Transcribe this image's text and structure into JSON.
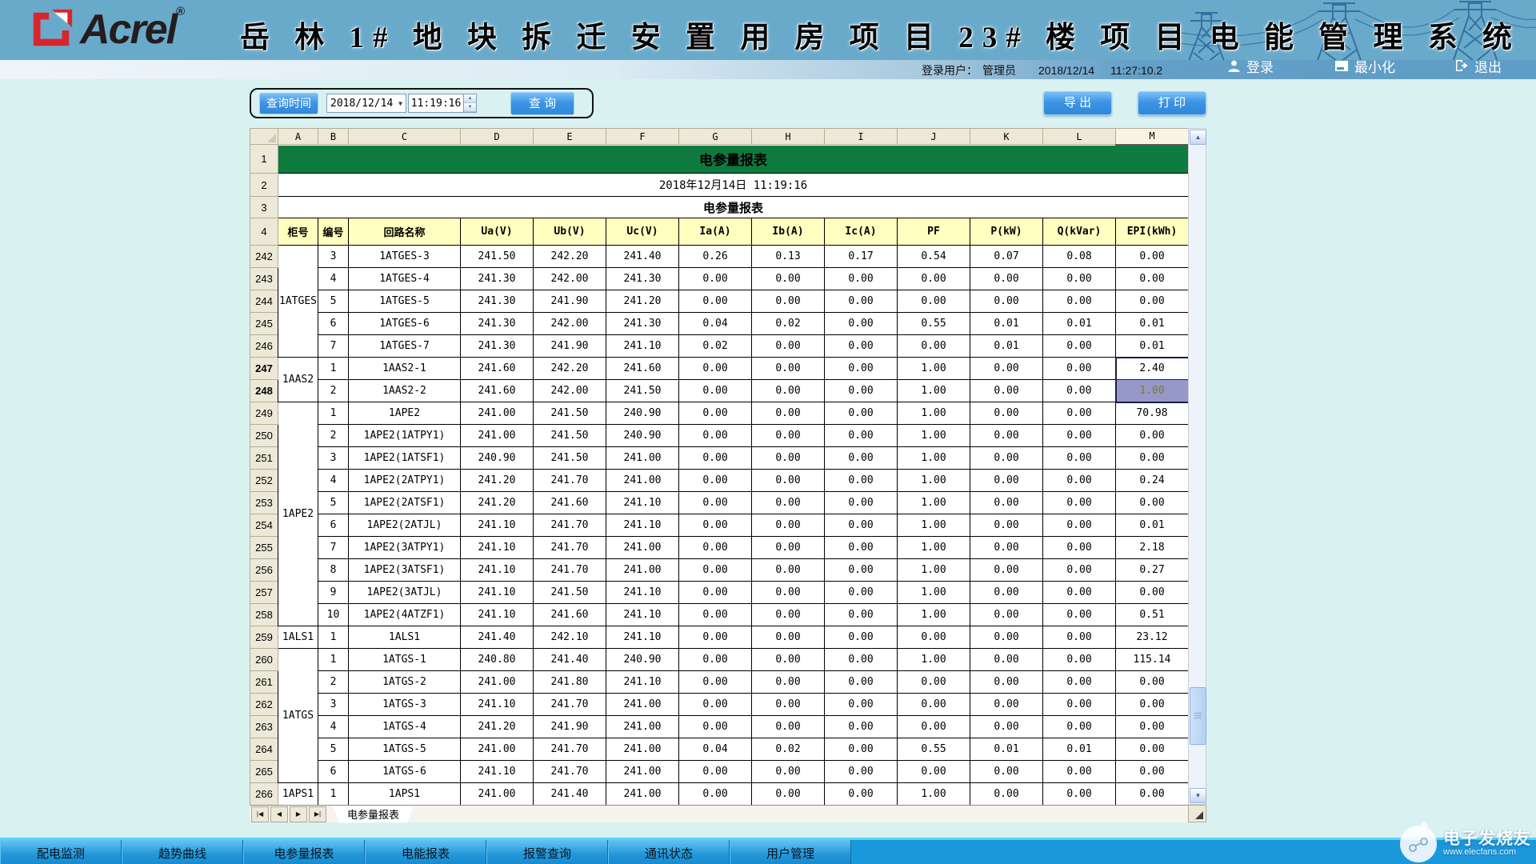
{
  "header": {
    "brand": "Acrel",
    "brand_reg": "®",
    "title": "岳 林 1# 地 块 拆 迁 安 置 用 房 项 目 23# 楼 项 目 电 能 管 理 系 统",
    "login_label": "登录用户：",
    "login_user": "管理员",
    "login_date": "2018/12/14",
    "login_time": "11:27:10.2",
    "btn_login": "登录",
    "btn_minimize": "最小化",
    "btn_exit": "退出"
  },
  "toolbar": {
    "query_time_label": "查询时间",
    "date_value": "2018/12/14",
    "time_value": "11:19:16",
    "query_button": "查 询",
    "export_button": "导 出",
    "print_button": "打 印"
  },
  "sheet": {
    "column_letters": [
      "A",
      "B",
      "C",
      "D",
      "E",
      "F",
      "G",
      "H",
      "I",
      "J",
      "K",
      "L",
      "M"
    ],
    "banner_gutter": [
      "1",
      "2",
      "3"
    ],
    "header_gutter": "4",
    "banner_title": "电参量报表",
    "report_datetime": "2018年12月14日 11:19:16",
    "report_title": "电参量报表",
    "columns": [
      "柜号",
      "编号",
      "回路名称",
      "Ua(V)",
      "Ub(V)",
      "Uc(V)",
      "Ia(A)",
      "Ib(A)",
      "Ic(A)",
      "PF",
      "P(kW)",
      "Q(kVar)",
      "EPI(kWh)"
    ],
    "tab_name": "电参量报表",
    "rows": [
      {
        "n": "242",
        "group": "1ATGES",
        "span": 5,
        "no": "3",
        "name": "1ATGES-3",
        "vals": [
          "241.50",
          "242.20",
          "241.40",
          "0.26",
          "0.13",
          "0.17",
          "0.54",
          "0.07",
          "0.08",
          "0.00"
        ]
      },
      {
        "n": "243",
        "no": "4",
        "name": "1ATGES-4",
        "vals": [
          "241.30",
          "242.00",
          "241.30",
          "0.00",
          "0.00",
          "0.00",
          "0.00",
          "0.00",
          "0.00",
          "0.00"
        ]
      },
      {
        "n": "244",
        "no": "5",
        "name": "1ATGES-5",
        "vals": [
          "241.30",
          "241.90",
          "241.20",
          "0.00",
          "0.00",
          "0.00",
          "0.00",
          "0.00",
          "0.00",
          "0.00"
        ]
      },
      {
        "n": "245",
        "no": "6",
        "name": "1ATGES-6",
        "vals": [
          "241.30",
          "242.00",
          "241.30",
          "0.04",
          "0.02",
          "0.00",
          "0.55",
          "0.01",
          "0.01",
          "0.01"
        ]
      },
      {
        "n": "246",
        "no": "7",
        "name": "1ATGES-7",
        "vals": [
          "241.30",
          "241.90",
          "241.10",
          "0.02",
          "0.00",
          "0.00",
          "0.00",
          "0.01",
          "0.00",
          "0.01"
        ]
      },
      {
        "n": "247",
        "bold": true,
        "group": "1AAS2",
        "span": 2,
        "no": "1",
        "name": "1AAS2-1",
        "sel": "active",
        "vals": [
          "241.60",
          "242.20",
          "241.60",
          "0.00",
          "0.00",
          "0.00",
          "1.00",
          "0.00",
          "0.00",
          "2.40"
        ]
      },
      {
        "n": "248",
        "bold": true,
        "no": "2",
        "name": "1AAS2-2",
        "sel": "fill",
        "vals": [
          "241.60",
          "242.00",
          "241.50",
          "0.00",
          "0.00",
          "0.00",
          "1.00",
          "0.00",
          "0.00",
          "1.00"
        ]
      },
      {
        "n": "249",
        "group": "1APE2",
        "span": 10,
        "no": "1",
        "name": "1APE2",
        "vals": [
          "241.00",
          "241.50",
          "240.90",
          "0.00",
          "0.00",
          "0.00",
          "1.00",
          "0.00",
          "0.00",
          "70.98"
        ]
      },
      {
        "n": "250",
        "no": "2",
        "name": "1APE2(1ATPY1)",
        "vals": [
          "241.00",
          "241.50",
          "240.90",
          "0.00",
          "0.00",
          "0.00",
          "1.00",
          "0.00",
          "0.00",
          "0.00"
        ]
      },
      {
        "n": "251",
        "no": "3",
        "name": "1APE2(1ATSF1)",
        "vals": [
          "240.90",
          "241.50",
          "241.00",
          "0.00",
          "0.00",
          "0.00",
          "1.00",
          "0.00",
          "0.00",
          "0.00"
        ]
      },
      {
        "n": "252",
        "no": "4",
        "name": "1APE2(2ATPY1)",
        "vals": [
          "241.20",
          "241.70",
          "241.00",
          "0.00",
          "0.00",
          "0.00",
          "1.00",
          "0.00",
          "0.00",
          "0.24"
        ]
      },
      {
        "n": "253",
        "no": "5",
        "name": "1APE2(2ATSF1)",
        "vals": [
          "241.20",
          "241.60",
          "241.10",
          "0.00",
          "0.00",
          "0.00",
          "1.00",
          "0.00",
          "0.00",
          "0.00"
        ]
      },
      {
        "n": "254",
        "no": "6",
        "name": "1APE2(2ATJL)",
        "vals": [
          "241.10",
          "241.70",
          "241.10",
          "0.00",
          "0.00",
          "0.00",
          "1.00",
          "0.00",
          "0.00",
          "0.01"
        ]
      },
      {
        "n": "255",
        "no": "7",
        "name": "1APE2(3ATPY1)",
        "vals": [
          "241.10",
          "241.70",
          "241.00",
          "0.00",
          "0.00",
          "0.00",
          "1.00",
          "0.00",
          "0.00",
          "2.18"
        ]
      },
      {
        "n": "256",
        "no": "8",
        "name": "1APE2(3ATSF1)",
        "vals": [
          "241.10",
          "241.70",
          "241.00",
          "0.00",
          "0.00",
          "0.00",
          "1.00",
          "0.00",
          "0.00",
          "0.27"
        ]
      },
      {
        "n": "257",
        "no": "9",
        "name": "1APE2(3ATJL)",
        "vals": [
          "241.10",
          "241.50",
          "241.10",
          "0.00",
          "0.00",
          "0.00",
          "1.00",
          "0.00",
          "0.00",
          "0.00"
        ]
      },
      {
        "n": "258",
        "no": "10",
        "name": "1APE2(4ATZF1)",
        "vals": [
          "241.10",
          "241.60",
          "241.10",
          "0.00",
          "0.00",
          "0.00",
          "1.00",
          "0.00",
          "0.00",
          "0.51"
        ]
      },
      {
        "n": "259",
        "group": "1ALS1",
        "span": 1,
        "no": "1",
        "name": "1ALS1",
        "vals": [
          "241.40",
          "242.10",
          "241.10",
          "0.00",
          "0.00",
          "0.00",
          "0.00",
          "0.00",
          "0.00",
          "23.12"
        ]
      },
      {
        "n": "260",
        "group": "1ATGS",
        "span": 6,
        "no": "1",
        "name": "1ATGS-1",
        "vals": [
          "240.80",
          "241.40",
          "240.90",
          "0.00",
          "0.00",
          "0.00",
          "1.00",
          "0.00",
          "0.00",
          "115.14"
        ]
      },
      {
        "n": "261",
        "no": "2",
        "name": "1ATGS-2",
        "vals": [
          "241.00",
          "241.80",
          "241.10",
          "0.00",
          "0.00",
          "0.00",
          "0.00",
          "0.00",
          "0.00",
          "0.00"
        ]
      },
      {
        "n": "262",
        "no": "3",
        "name": "1ATGS-3",
        "vals": [
          "241.10",
          "241.70",
          "241.00",
          "0.00",
          "0.00",
          "0.00",
          "0.00",
          "0.00",
          "0.00",
          "0.00"
        ]
      },
      {
        "n": "263",
        "no": "4",
        "name": "1ATGS-4",
        "vals": [
          "241.20",
          "241.90",
          "241.00",
          "0.00",
          "0.00",
          "0.00",
          "0.00",
          "0.00",
          "0.00",
          "0.00"
        ]
      },
      {
        "n": "264",
        "no": "5",
        "name": "1ATGS-5",
        "vals": [
          "241.00",
          "241.70",
          "241.00",
          "0.04",
          "0.02",
          "0.00",
          "0.55",
          "0.01",
          "0.01",
          "0.00"
        ]
      },
      {
        "n": "265",
        "no": "6",
        "name": "1ATGS-6",
        "vals": [
          "241.10",
          "241.70",
          "241.00",
          "0.00",
          "0.00",
          "0.00",
          "0.00",
          "0.00",
          "0.00",
          "0.00"
        ]
      },
      {
        "n": "266",
        "group": "1APS1",
        "span": 1,
        "no": "1",
        "name": "1APS1",
        "vals": [
          "241.00",
          "241.40",
          "241.00",
          "0.00",
          "0.00",
          "0.00",
          "1.00",
          "0.00",
          "0.00",
          "0.00"
        ]
      }
    ]
  },
  "bottom_nav": {
    "items": [
      "配电监测",
      "趋势曲线",
      "电参量报表",
      "电能报表",
      "报警查询",
      "通讯状态",
      "用户管理"
    ]
  },
  "watermark": {
    "line1": "电子发烧友",
    "line2": "www.elecfans.com"
  },
  "colors": {
    "header_blue": "#69aacb",
    "banner_green": "#0e7a3e",
    "field_header_yellow": "#ffffc0",
    "selection_fill": "#9598c8",
    "bottom_bar_blue": "#1b98dc",
    "button_blue": "#2f88d8",
    "brand_red": "#d8262c"
  }
}
